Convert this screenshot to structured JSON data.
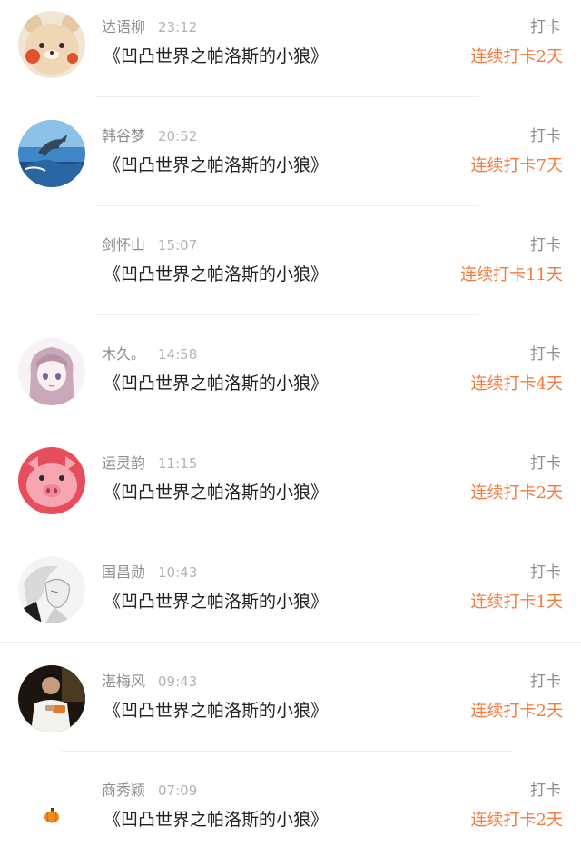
{
  "entries": [
    {
      "name": "达语柳",
      "time": "23:12",
      "type_label": "打卡",
      "book": "《凹凸世界之帕洛斯的小狼》",
      "streak": "连续打卡2天",
      "avatar_icon": "bear-face-icon"
    },
    {
      "name": "韩谷梦",
      "time": "20:52",
      "type_label": "打卡",
      "book": "《凹凸世界之帕洛斯的小狼》",
      "streak": "连续打卡7天",
      "avatar_icon": "dolphin-icon"
    },
    {
      "name": "剑怀山",
      "time": "15:07",
      "type_label": "打卡",
      "book": "《凹凸世界之帕洛斯的小狼》",
      "streak": "连续打卡11天",
      "avatar_icon": ""
    },
    {
      "name": "木久。",
      "time": "14:58",
      "type_label": "打卡",
      "book": "《凹凸世界之帕洛斯的小狼》",
      "streak": "连续打卡4天",
      "avatar_icon": "anime-girl-icon"
    },
    {
      "name": "运灵韵",
      "time": "11:15",
      "type_label": "打卡",
      "book": "《凹凸世界之帕洛斯的小狼》",
      "streak": "连续打卡2天",
      "avatar_icon": "pig-face-icon"
    },
    {
      "name": "国昌勋",
      "time": "10:43",
      "type_label": "打卡",
      "book": "《凹凸世界之帕洛斯的小狼》",
      "streak": "连续打卡1天",
      "avatar_icon": "sketch-portrait-icon"
    },
    {
      "name": "湛梅风",
      "time": "09:43",
      "type_label": "打卡",
      "book": "《凹凸世界之帕洛斯的小狼》",
      "streak": "连续打卡2天",
      "avatar_icon": "person-photo-icon"
    },
    {
      "name": "商秀颖",
      "time": "07:09",
      "type_label": "打卡",
      "book": "《凹凸世界之帕洛斯的小狼》",
      "streak": "连续打卡2天",
      "avatar_icon": "pumpkin-icon"
    }
  ],
  "colors": {
    "streak": "#f47a3e",
    "meta": "#8e8e8e",
    "book": "#222222"
  }
}
